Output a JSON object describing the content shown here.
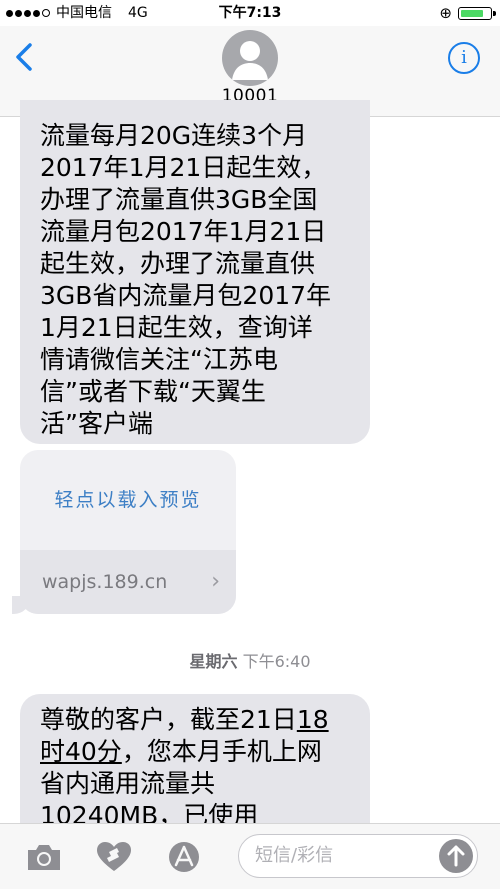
{
  "status_bar": {
    "carrier": "中国电信",
    "network": "4G",
    "time": "下午7:13"
  },
  "header": {
    "contact": "10001",
    "back_icon": "chevron-left-icon",
    "info_icon": "info-icon",
    "accent": "#1a7ee8"
  },
  "messages": {
    "first_text": "流量每月20G连续3个月\n2017年1月21日起生效，\n办理了流量直供3GB全国\n流量月包2017年1月21日\n起生效，办理了流量直供\n3GB省内流量月包2017年\n1月21日起生效，查询详\n情请微信关注“江苏电\n信”或者下载“天翼生\n活”客户端",
    "link_preview": "轻点以载入预览",
    "link_url": "wapjs.189.cn",
    "timestamp_day": "星期六",
    "timestamp_time": "下午6:40",
    "second_text_a": "尊敬的客户，截至21日",
    "second_text_u1": "18",
    "second_text_b": "\n",
    "second_text_u2": "时40分",
    "second_text_c": "，您本月手机上网\n省内通用流量共\n10240MB，已使用"
  },
  "toolbar": {
    "compose_placeholder": "短信/彩信",
    "icons": [
      "camera-icon",
      "digital-touch-icon",
      "app-store-icon",
      "send-icon"
    ]
  }
}
